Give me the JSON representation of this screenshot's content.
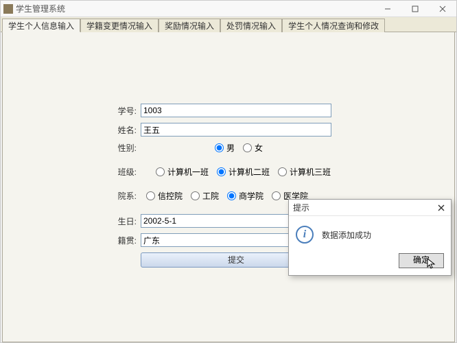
{
  "window": {
    "title": "学生管理系统"
  },
  "tabs": [
    {
      "label": "学生个人信息输入",
      "active": true
    },
    {
      "label": "学籍变更情况输入",
      "active": false
    },
    {
      "label": "奖励情况输入",
      "active": false
    },
    {
      "label": "处罚情况输入",
      "active": false
    },
    {
      "label": "学生个人情况查询和修改",
      "active": false
    }
  ],
  "form": {
    "student_id": {
      "label": "学号:",
      "value": "1003"
    },
    "name": {
      "label": "姓名:",
      "value": "王五"
    },
    "gender": {
      "label": "性别:",
      "options": [
        {
          "label": "男",
          "checked": true
        },
        {
          "label": "女",
          "checked": false
        }
      ]
    },
    "class": {
      "label": "班级:",
      "options": [
        {
          "label": "计算机一班",
          "checked": false
        },
        {
          "label": "计算机二班",
          "checked": true
        },
        {
          "label": "计算机三班",
          "checked": false
        }
      ]
    },
    "department": {
      "label": "院系:",
      "options": [
        {
          "label": "信控院",
          "checked": false
        },
        {
          "label": "工院",
          "checked": false
        },
        {
          "label": "商学院",
          "checked": true
        },
        {
          "label": "医学院",
          "checked": false
        }
      ]
    },
    "birthday": {
      "label": "生日:",
      "value": "2002-5-1"
    },
    "hometown": {
      "label": "籍贯:",
      "value": "广东"
    },
    "submit_label": "提交"
  },
  "dialog": {
    "title": "提示",
    "message": "数据添加成功",
    "ok_label": "确定"
  }
}
